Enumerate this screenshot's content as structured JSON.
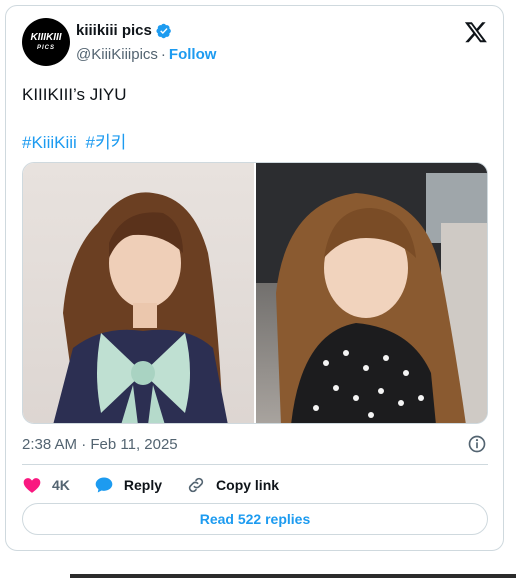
{
  "author": {
    "avatar_text_main": "KIIIKIII",
    "avatar_text_sub": "PICS",
    "display_name": "kiiikiii pics",
    "handle": "@KiiiKiiipics",
    "separator": "·",
    "follow_label": "Follow"
  },
  "post": {
    "text": "KIIIKIII’s JIYU",
    "hashtags": [
      "#KiiiKiii",
      "#키키"
    ],
    "timestamp": "2:38 AM · Feb 11, 2025"
  },
  "actions": {
    "like_count": "4K",
    "reply_label": "Reply",
    "copy_label": "Copy link"
  },
  "read_replies_label": "Read 522 replies",
  "colors": {
    "accent": "#1d9bf0",
    "like": "#f91880",
    "text": "#0f1419",
    "muted": "#536471",
    "border": "#cfd9de"
  },
  "icons": [
    "verified-icon",
    "x-logo-icon",
    "info-icon",
    "heart-icon",
    "reply-icon",
    "link-icon"
  ]
}
